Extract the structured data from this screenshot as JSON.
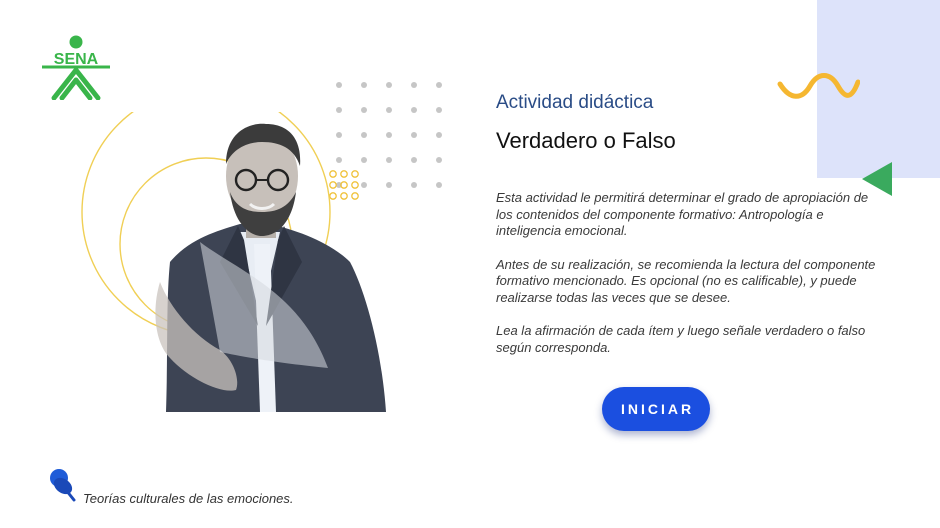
{
  "logo": {
    "text": "SENA",
    "color": "#39b54a"
  },
  "activity": {
    "kicker": "Actividad didáctica",
    "title": "Verdadero o Falso",
    "paragraphs": [
      "Esta actividad le permitirá determinar el grado de apropiación de los contenidos del componente formativo: Antropología e inteligencia emocional.",
      "Antes de su realización, se recomienda la lectura del componente formativo mencionado. Es opcional (no es calificable), y puede realizarse todas las veces que se desee.",
      "Lea la afirmación de cada ítem y luego señale verdadero o falso según corresponda."
    ],
    "start_button": "INICIAR"
  },
  "footer": {
    "note": "Teorías culturales de las emociones.",
    "icon": "pushpin-icon"
  },
  "colors": {
    "accent_blue": "#1b4fe0",
    "kicker_blue": "#2a4c86",
    "lilac_panel": "#dde3fa",
    "green": "#3aaa5e",
    "yellow": "#f5b731"
  }
}
